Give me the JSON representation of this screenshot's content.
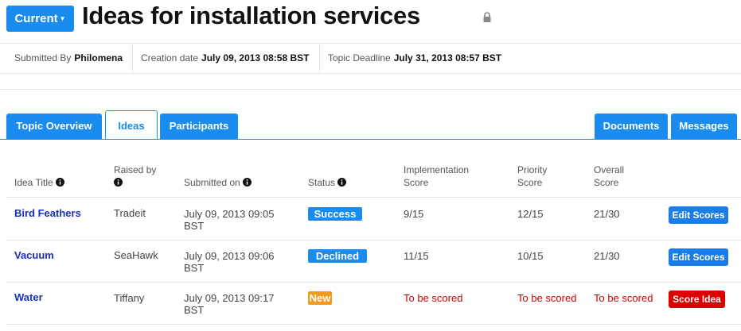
{
  "header": {
    "current_label": "Current",
    "caret": "▼",
    "title": "Ideas for installation services",
    "lock_icon": "lock-icon"
  },
  "meta": {
    "submitted_by_label": "Submitted By",
    "submitted_by_value": "Philomena",
    "creation_date_label": "Creation date",
    "creation_date_value": "July 09, 2013 08:58 BST",
    "deadline_label": "Topic Deadline",
    "deadline_value": "July 31, 2013 08:57 BST"
  },
  "tabs": {
    "overview": "Topic Overview",
    "ideas": "Ideas",
    "participants": "Participants",
    "documents": "Documents",
    "messages": "Messages"
  },
  "table": {
    "headers": {
      "title": "Idea Title",
      "raised_by": "Raised by",
      "submitted_on": "Submitted on",
      "status": "Status",
      "impl_score_1": "Implementation",
      "impl_score_2": "Score",
      "priority_1": "Priority",
      "priority_2": "Score",
      "overall_1": "Overall",
      "overall_2": "Score"
    },
    "rows": [
      {
        "title": "Bird Feathers",
        "raised_by": "Tradeit",
        "submitted_1": "July 09, 2013 09:05",
        "submitted_2": "BST",
        "status": "Success",
        "impl": "9/15",
        "priority": "12/15",
        "overall": "21/30",
        "action": "Edit Scores"
      },
      {
        "title": "Vacuum",
        "raised_by": "SeaHawk",
        "submitted_1": "July 09, 2013 09:06",
        "submitted_2": "BST",
        "status": "Declined",
        "impl": "11/15",
        "priority": "10/15",
        "overall": "21/30",
        "action": "Edit Scores"
      },
      {
        "title": "Water",
        "raised_by": "Tiffany",
        "submitted_1": "July 09, 2013 09:17",
        "submitted_2": "BST",
        "status": "New",
        "impl": "To be scored",
        "priority": "To be scored",
        "overall": "To be scored",
        "action": "Score Idea"
      }
    ]
  },
  "colors": {
    "accent": "#1a8cf0",
    "success_badge": "#1a8cf0",
    "declined_badge": "#1a8cf0",
    "new_badge": "#f39a1c",
    "unscored_text": "#d40000",
    "score_idea_button": "#dd0000",
    "link": "#1a2fbf"
  }
}
